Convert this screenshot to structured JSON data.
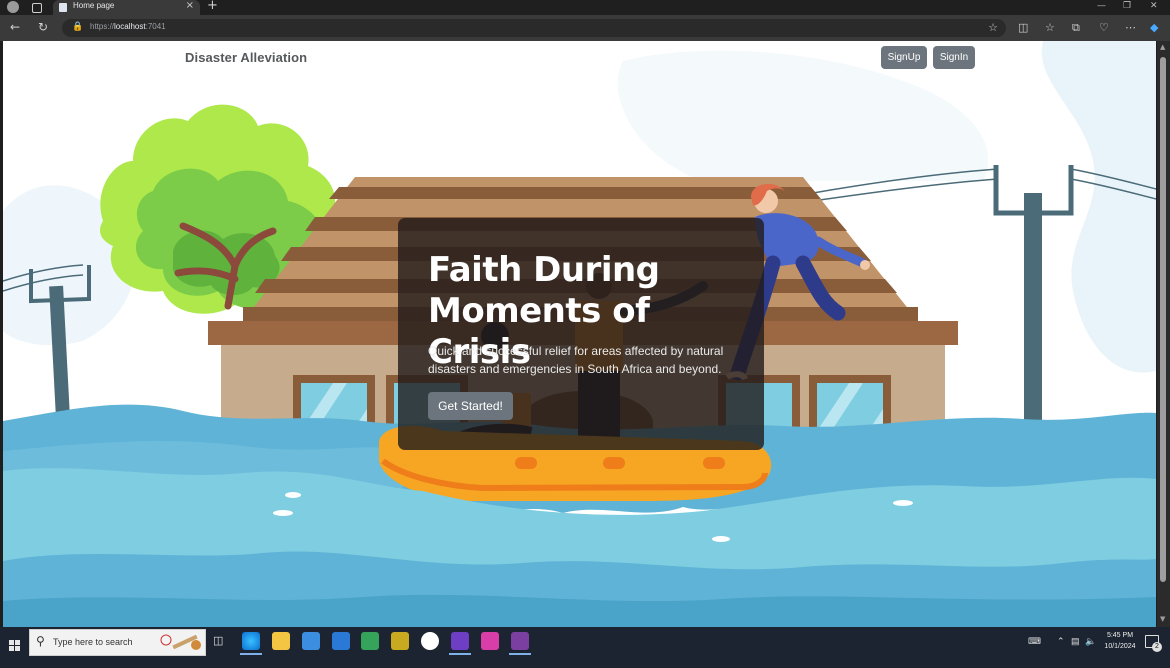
{
  "browser": {
    "tab_title": "Home page",
    "new_tab": "+",
    "tab_close": "×",
    "url_scheme": "https://",
    "url_host": "localhost",
    "url_port": ":7041"
  },
  "navbar": {
    "brand": "Disaster Alleviation",
    "signup_label": "SignUp",
    "signin_label": "SignIn"
  },
  "hero": {
    "title": "Faith During Moments of Crisis",
    "description": "Quick and successful relief for areas affected by natural disasters and emergencies in South Africa and beyond.",
    "cta_label": "Get Started!"
  },
  "taskbar": {
    "search_placeholder": "Type here to search",
    "time": "5:45 PM",
    "date": "10/1/2024",
    "notification_count": "2"
  },
  "colors": {
    "button_gray": "#6c757d",
    "water_blue": "#5fb3d6",
    "raft_orange": "#f6a623",
    "tree_green": "#76c442"
  }
}
